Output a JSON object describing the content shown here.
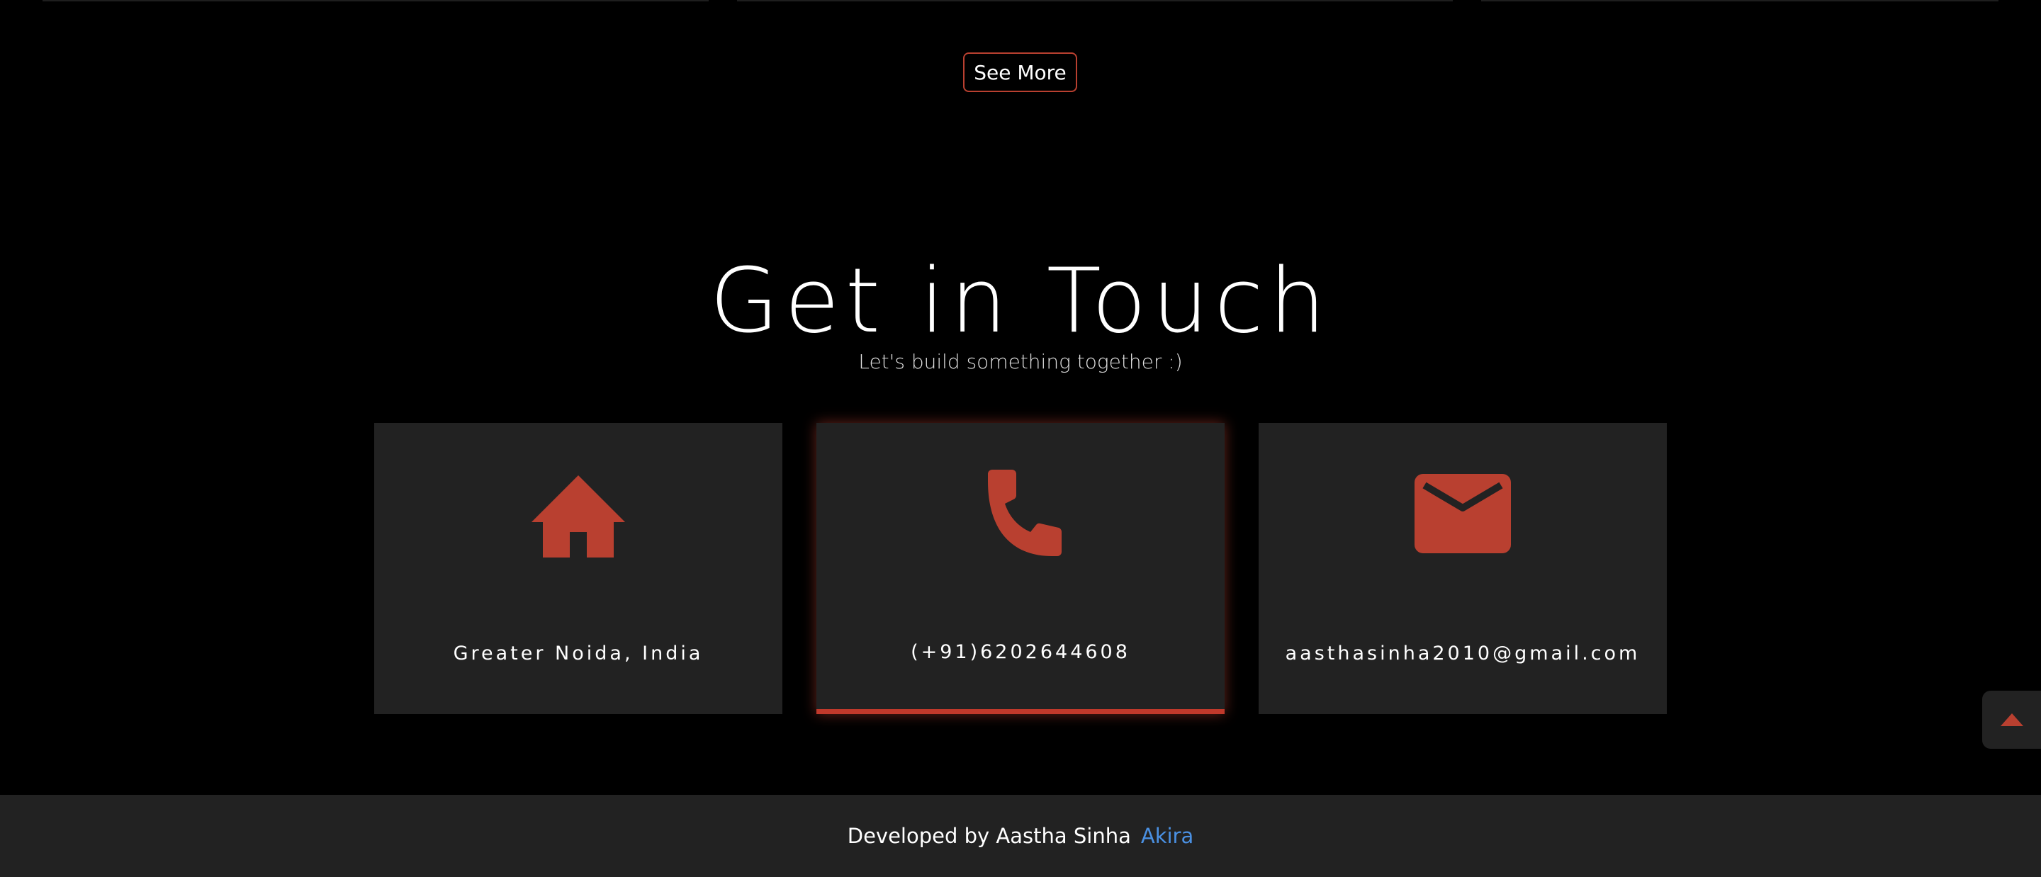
{
  "see_more": {
    "label": "See More"
  },
  "contact": {
    "title": "Get in Touch",
    "subtitle": "Let's build something together :)",
    "cards": [
      {
        "icon": "home-icon",
        "text": "Greater Noida, India"
      },
      {
        "icon": "phone-icon",
        "text": "(+91)6202644608"
      },
      {
        "icon": "envelope-icon",
        "text": "aasthasinha2010@gmail.com"
      }
    ]
  },
  "footer": {
    "text": "Developed by Aastha Sinha",
    "link_label": "Akira"
  },
  "scroll_top": {
    "icon": "caret-up-icon"
  },
  "colors": {
    "background": "#000000",
    "card": "#222222",
    "accent": "#b94030",
    "link": "#4a90e2",
    "text": "#ffffff"
  }
}
